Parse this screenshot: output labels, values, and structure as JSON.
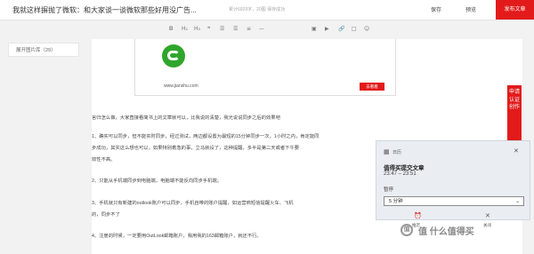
{
  "header": {
    "title": "我就这样摒抛了微软：和大家谈一谈微软那些好用没广告...",
    "meta": "累计6929字，20图  保存成功",
    "save_label": "保存",
    "preview_label": "预览",
    "publish_label": "发布文章"
  },
  "toolbar": {
    "icons": [
      "bold-icon",
      "heading-icon",
      "heading-small-icon",
      "quote-icon",
      "list-icon",
      "ordered-list-icon",
      "align-icon",
      "divider-icon",
      "image-icon",
      "video-icon",
      "link-icon",
      "product-icon",
      "emoji-icon"
    ]
  },
  "sidebar": {
    "gallery_label": "展开图片库（29）"
  },
  "quote_card": {
    "domain": "www.jianshu.com",
    "button": "去看看"
  },
  "article": {
    "paragraphs": [
      "言归怎么做，大家直接看简书上的文章就可以，比我说的清楚，我光说说同步之后的效果吧",
      "1、确实可以同步，但不能实时同步，经过测试，两边都设置为最短的15分钟同步一次，1小时之内，肯定能同",
      "步成功，其实这么想也可以，如果特别着急的事，立马就设了，这种提醒，多半是第二天或者下午要",
      "效性不高。",
      "2、只能从手机端同步到电脑端，电脑端不能反向同步手机端；",
      "3、手机就只有新建的outlook账户可以同步，手机自带的账户提醒，如运营商短信提醒火车、飞机",
      "的，同步不了",
      "4、注册的时候，一定要用OutLook邮箱账户，我用我的163邮箱账户，就还不行。"
    ]
  },
  "side_tag": {
    "text": "申请认证创作"
  },
  "toast": {
    "app_name": "日历",
    "title": "值得买提交文章",
    "time": "23:47 – 23:51",
    "snooze_label": "暂停",
    "snooze_value": "5 分钟",
    "snooze_button": "推迟",
    "dismiss_button": "关闭"
  },
  "watermark": {
    "text": "值 什么值得买",
    "logo": "值"
  }
}
